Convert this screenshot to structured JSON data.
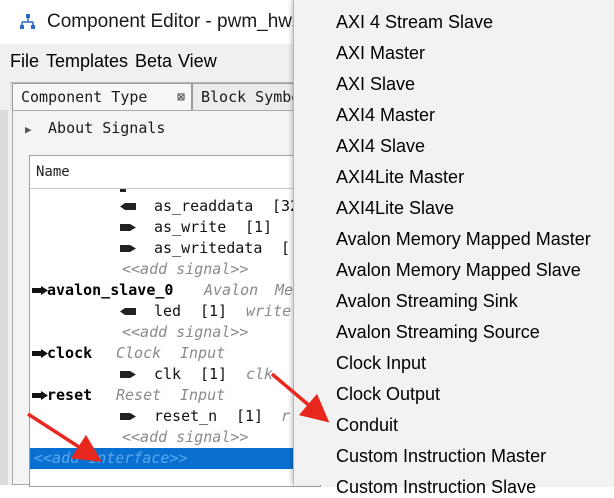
{
  "window": {
    "title": "Component Editor - pwm_hw.t"
  },
  "menubar": {
    "items": [
      "File",
      "Templates",
      "Beta",
      "View"
    ]
  },
  "tabs": {
    "component_type": "Component Type",
    "block_symbol": "Block Symbo",
    "close_glyph": "⊠"
  },
  "panel": {
    "about_label": "About Signals"
  },
  "tree": {
    "header": "Name",
    "rows": [
      {
        "kind": "signal",
        "name": "as_readdata",
        "extra": "[32"
      },
      {
        "kind": "signal",
        "name": "as_write",
        "extra": "[1]"
      },
      {
        "kind": "signal",
        "name": "as_writedata",
        "extra": "["
      },
      {
        "kind": "add-signal",
        "text": "<<add signal>>"
      },
      {
        "kind": "interface",
        "name": "avalon_slave_0",
        "type": "Avalon",
        "extra": "Me"
      },
      {
        "kind": "signal",
        "name": "led",
        "extra": "[1]",
        "role": "write"
      },
      {
        "kind": "add-signal",
        "text": "<<add signal>>"
      },
      {
        "kind": "interface",
        "name": "clock",
        "type": "Clock",
        "extra": "Input"
      },
      {
        "kind": "signal",
        "name": "clk",
        "extra": "[1]",
        "role": "clk"
      },
      {
        "kind": "interface",
        "name": "reset",
        "type": "Reset",
        "extra": "Input"
      },
      {
        "kind": "signal",
        "name": "reset_n",
        "extra": "[1]",
        "role": "r"
      },
      {
        "kind": "add-signal",
        "text": "<<add signal>>"
      },
      {
        "kind": "add-interface",
        "text": "<<add interface>>"
      }
    ]
  },
  "popup_menu": {
    "items": [
      "AXI 4 Stream Slave",
      "AXI Master",
      "AXI Slave",
      "AXI4 Master",
      "AXI4 Slave",
      "AXI4Lite Master",
      "AXI4Lite Slave",
      "Avalon Memory Mapped Master",
      "Avalon Memory Mapped Slave",
      "Avalon Streaming Sink",
      "Avalon Streaming Source",
      "Clock Input",
      "Clock Output",
      "Conduit",
      "Custom Instruction Master",
      "Custom Instruction Slave"
    ]
  },
  "colors": {
    "selection": "#0a70d0",
    "annotation_arrow": "#e8281e"
  }
}
